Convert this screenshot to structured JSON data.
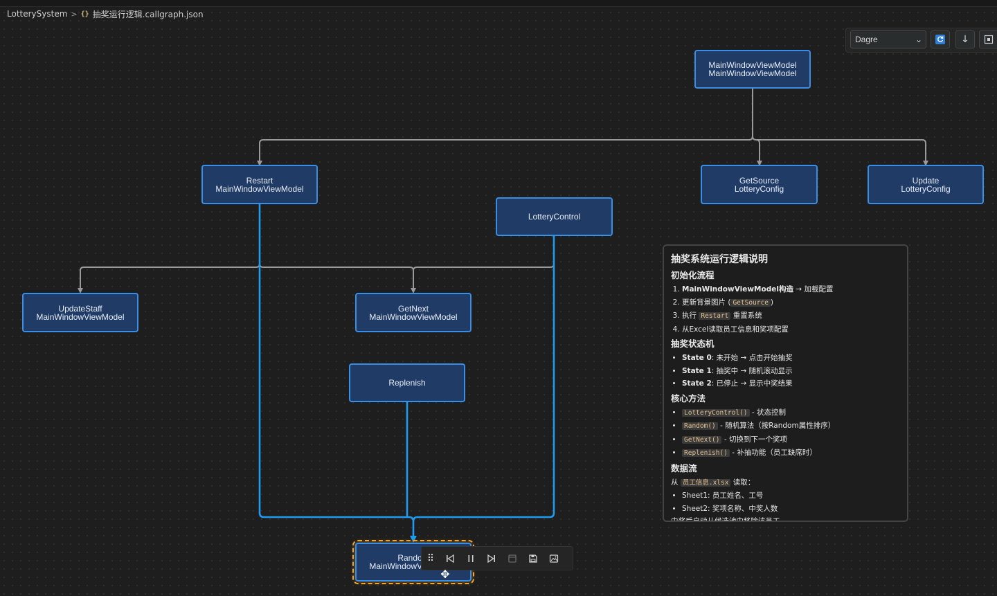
{
  "breadcrumb": {
    "project": "LotterySystem",
    "file_icon": "{}",
    "file": "抽奖运行逻辑.callgraph.json"
  },
  "toolbar": {
    "layout_value": "Dagre",
    "refresh_icon": "refresh-icon",
    "download_icon": "download-icon",
    "fit_icon": "fit-view-icon"
  },
  "nodes": [
    {
      "id": "mwvm",
      "line1": "MainWindowViewModel",
      "line2": "MainWindowViewModel"
    },
    {
      "id": "restart",
      "line1": "Restart",
      "line2": "MainWindowViewModel"
    },
    {
      "id": "getsource",
      "line1": "GetSource",
      "line2": "LotteryConfig"
    },
    {
      "id": "update",
      "line1": "Update",
      "line2": "LotteryConfig"
    },
    {
      "id": "lotterycontrol",
      "line1": "LotteryControl",
      "line2": ""
    },
    {
      "id": "updatestaff",
      "line1": "UpdateStaff",
      "line2": "MainWindowViewModel"
    },
    {
      "id": "getnext",
      "line1": "GetNext",
      "line2": "MainWindowViewModel"
    },
    {
      "id": "replenish",
      "line1": "Replenish",
      "line2": ""
    },
    {
      "id": "random",
      "line1": "Random",
      "line2": "MainWindowViewModel"
    }
  ],
  "note": {
    "title": "抽奖系统运行逻辑说明",
    "init_heading": "初始化流程",
    "init_1_bold": "MainWindowViewModel构造",
    "init_1_rest": " → 加载配置",
    "init_2_pre": "更新背景图片 (",
    "init_2_code": "GetSource",
    "init_2_post": ")",
    "init_3_pre": "执行 ",
    "init_3_code": "Restart",
    "init_3_post": " 重置系统",
    "init_4": "从Excel读取员工信息和奖项配置",
    "state_heading": "抽奖状态机",
    "state_0_bold": "State 0",
    "state_0_rest": ": 未开始 → 点击开始抽奖",
    "state_1_bold": "State 1",
    "state_1_rest": ": 抽奖中 → 随机滚动显示",
    "state_2_bold": "State 2",
    "state_2_rest": ": 已停止 → 显示中奖结果",
    "core_heading": "核心方法",
    "core_1_code": "LotteryControl()",
    "core_1_rest": " - 状态控制",
    "core_2_code": "Random()",
    "core_2_rest": " - 随机算法（按Random属性排序）",
    "core_3_code": "GetNext()",
    "core_3_rest": " - 切换到下一个奖项",
    "core_4_code": "Replenish()",
    "core_4_rest": " - 补抽功能（员工缺席时）",
    "data_heading": "数据流",
    "data_from_pre": "从 ",
    "data_from_code": "员工信息.xlsx",
    "data_from_post": " 读取：",
    "data_1": "Sheet1: 员工姓名、工号",
    "data_2": "Sheet2: 奖项名称、中奖人数",
    "data_footer": "中奖后自动从候选池中移除该员工。"
  },
  "player": {
    "drag_icon": "drag-handle-icon",
    "prev_icon": "step-back-icon",
    "pause_icon": "pause-icon",
    "next_icon": "step-forward-icon",
    "stop_icon": "stop-icon",
    "save_icon": "save-icon",
    "export_image_icon": "export-image-icon"
  },
  "colors": {
    "node_fill": "#1f3b66",
    "node_border": "#3a8ee6",
    "edge_gray": "#9a9a9a",
    "edge_active": "#1e9bf0",
    "selection": "#f0a733"
  }
}
